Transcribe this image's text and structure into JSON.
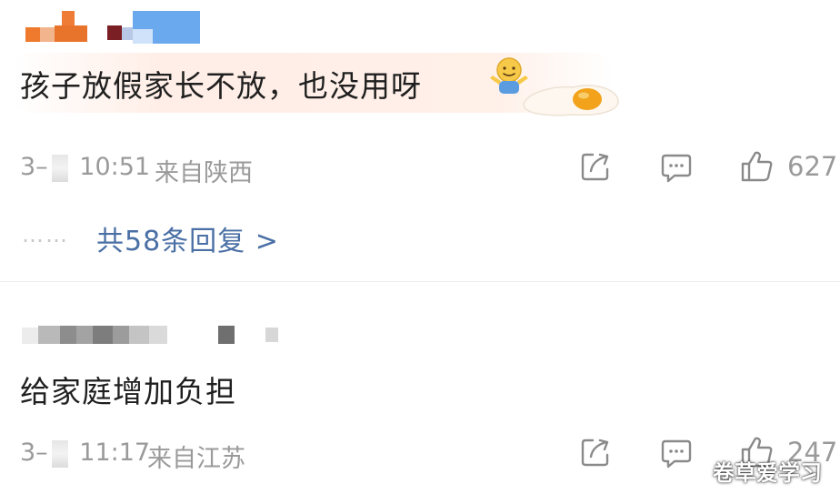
{
  "comments": [
    {
      "text": "孩子放假家长不放，也没用呀",
      "time_prefix": "3–",
      "time": "10:51",
      "location": "来自陕西",
      "likes": "627",
      "replies_dots": "……",
      "replies_label": "共58条回复 >"
    },
    {
      "text": "给家庭增加负担",
      "time_prefix": "3–",
      "time": "11:17",
      "location": "来自江苏",
      "likes": "247"
    }
  ],
  "icons": [
    "share-icon",
    "comment-icon",
    "like-icon",
    "shrug-emoji-icon",
    "fried-egg-sticker-icon"
  ],
  "colors": {
    "reply_link": "#4a6fa5",
    "meta_gray": "#9a9a9a",
    "avatar_orange": "#e8742c",
    "avatar_blue": "#6aa9ee"
  },
  "watermark": "卷草爱学习"
}
